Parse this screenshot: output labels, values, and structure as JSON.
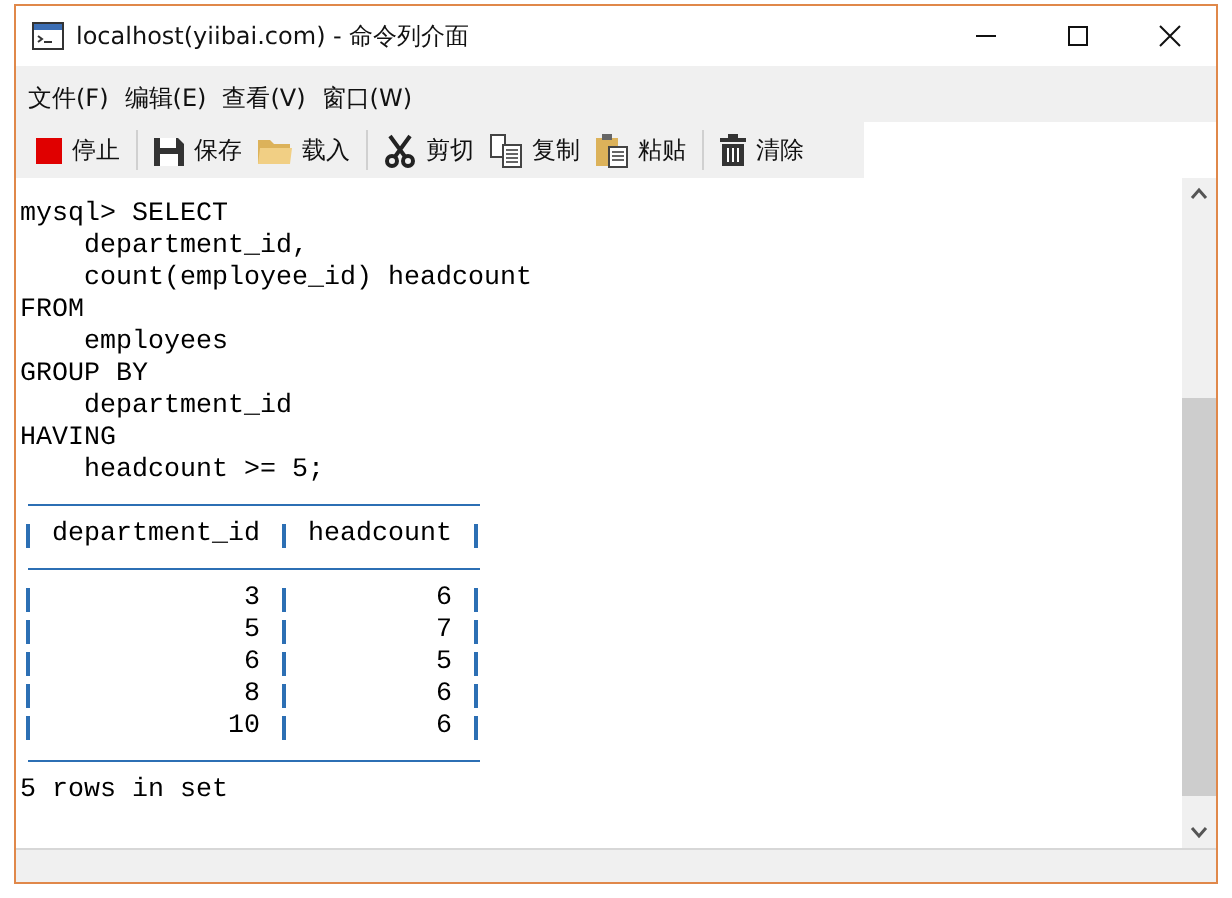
{
  "window": {
    "title": "localhost(yiibai.com) - 命令列介面"
  },
  "menu": [
    "文件(F)",
    "编辑(E)",
    "查看(V)",
    "窗口(W)"
  ],
  "toolbar": [
    {
      "kind": "stop",
      "label": "停止"
    },
    {
      "kind": "sep"
    },
    {
      "kind": "save",
      "label": "保存"
    },
    {
      "kind": "load",
      "label": "载入"
    },
    {
      "kind": "sep"
    },
    {
      "kind": "cut",
      "label": "剪切"
    },
    {
      "kind": "copy",
      "label": "复制"
    },
    {
      "kind": "paste",
      "label": "粘贴"
    },
    {
      "kind": "sep"
    },
    {
      "kind": "clear",
      "label": "清除"
    }
  ],
  "query": [
    "mysql> SELECT",
    "    department_id,",
    "    count(employee_id) headcount",
    "FROM",
    "    employees",
    "GROUP BY",
    "    department_id",
    "HAVING",
    "    headcount >= 5;"
  ],
  "result": {
    "columns": [
      "department_id",
      "headcount"
    ],
    "rows": [
      [
        "3",
        "6"
      ],
      [
        "5",
        "7"
      ],
      [
        "6",
        "5"
      ],
      [
        "8",
        "6"
      ],
      [
        "10",
        "6"
      ]
    ]
  },
  "footer": "5 rows in set"
}
